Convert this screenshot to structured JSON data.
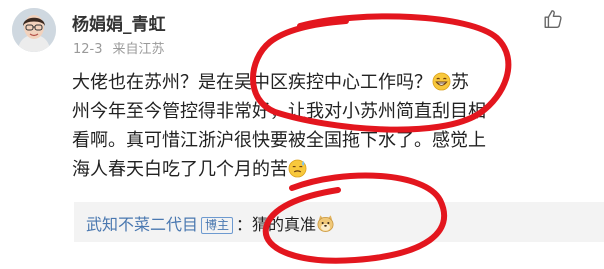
{
  "comment": {
    "username": "杨娟娟_青虹",
    "date": "12-3",
    "source": "来自江苏",
    "line1": "大佬也在苏州？是在吴中区疾控中心工作吗？",
    "line1_tail": "苏",
    "line2": "州今年至今管控得非常好，让我对小苏州简直刮目相",
    "line3": "看啊。真可惜江浙沪很快要被全国拖下水了。感觉上",
    "line4": "海人春天白吃了几个月的苦",
    "icons": {
      "avatar": "avatar-photo",
      "like": "thumbs-up-icon",
      "emoji1": "grin-emoji-icon",
      "emoji2": "sweat-emoji-icon",
      "emoji3": "doge-emoji-icon"
    }
  },
  "reply": {
    "name": "武知不菜二代目",
    "badge": "博主",
    "separator": "：",
    "text": "猜的真准"
  },
  "colors": {
    "link_blue": "#4a78b0",
    "meta_gray": "#9a9a9a",
    "reply_bg": "#f3f3f3",
    "marker_red": "#e3161e"
  }
}
